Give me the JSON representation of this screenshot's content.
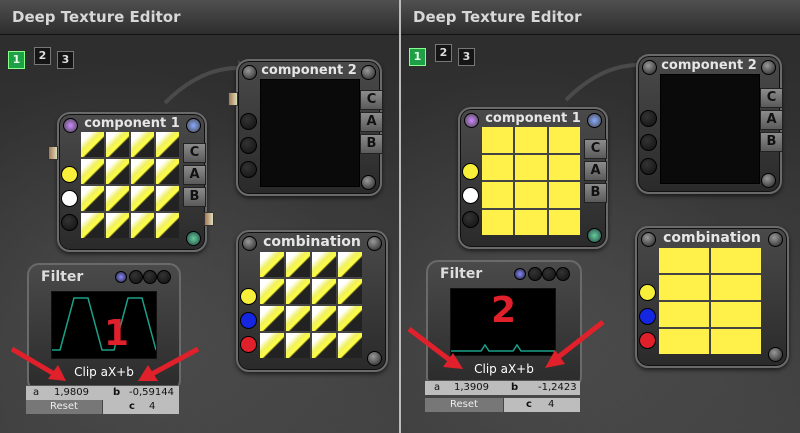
{
  "app": {
    "title": "Deep Texture Editor"
  },
  "pages": [
    "1",
    "2",
    "3"
  ],
  "labels": {
    "component1": "component 1",
    "component2": "component 2",
    "combination": "combination",
    "filter": "Filter",
    "btn_c": "C",
    "btn_a": "A",
    "btn_b": "B",
    "reset": "Reset",
    "a": "a",
    "b": "b",
    "c": "c"
  },
  "left": {
    "clip": "Clip aX+b",
    "a_value": "1,9809",
    "b_value": "-0,59144",
    "c_value": "4",
    "marker": "1"
  },
  "right": {
    "clip": "Clip aX+b",
    "a_value": "1,3909",
    "b_value": "-1,2423",
    "c_value": "4",
    "marker": "2"
  },
  "colors": {
    "accent_red": "#e0202a",
    "yellow": "#fff14a",
    "active_page": "#1ea047"
  }
}
